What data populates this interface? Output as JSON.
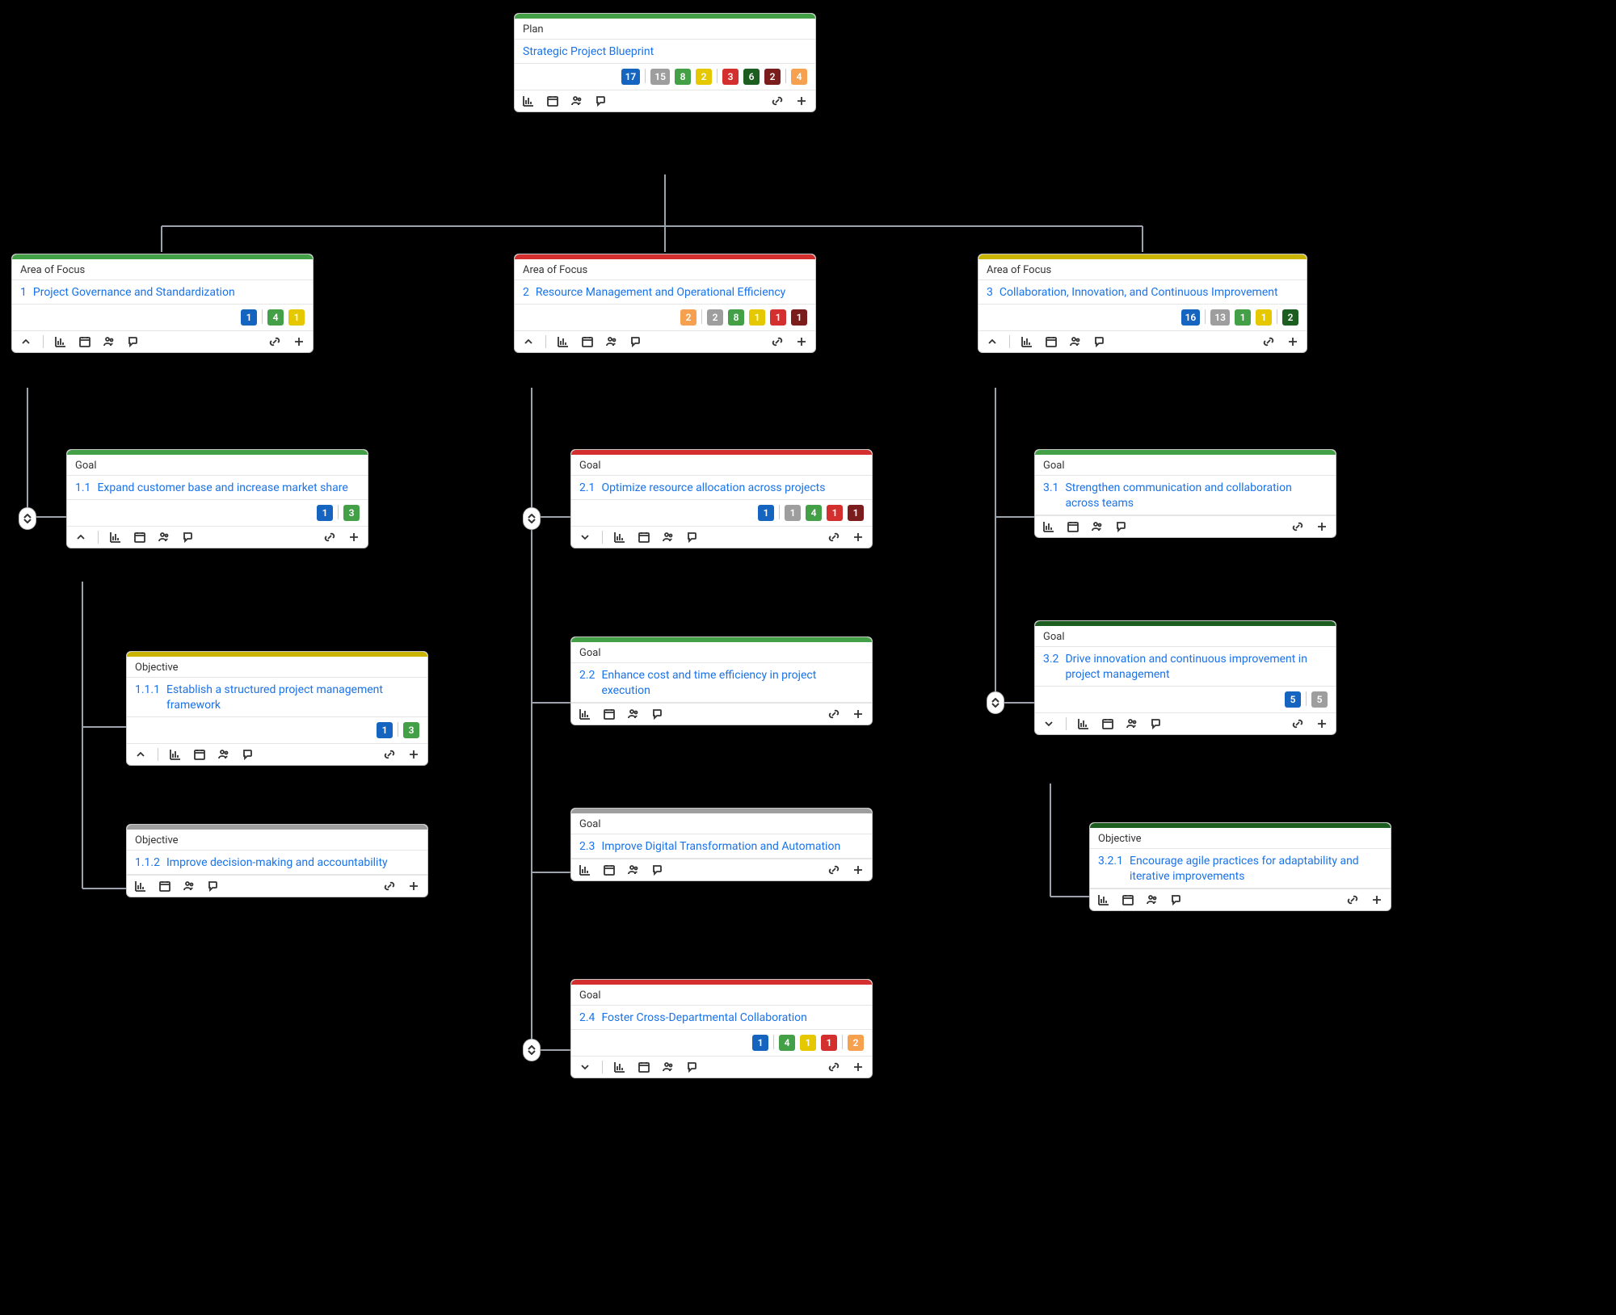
{
  "labels": {
    "plan": "Plan",
    "area": "Area of Focus",
    "goal": "Goal",
    "objective": "Objective"
  },
  "plan": {
    "title": "Strategic Project Blueprint",
    "badges": [
      {
        "color": "c-blue",
        "value": "17"
      },
      {
        "sep": true
      },
      {
        "color": "c-gray",
        "value": "15"
      },
      {
        "color": "c-lime",
        "value": "8"
      },
      {
        "color": "c-yellow",
        "value": "2"
      },
      {
        "sep": true
      },
      {
        "color": "c-red",
        "value": "3"
      },
      {
        "color": "c-dkgreen",
        "value": "6"
      },
      {
        "color": "c-darkred",
        "value": "2"
      },
      {
        "sep": true
      },
      {
        "color": "c-orange",
        "value": "4"
      }
    ]
  },
  "area1": {
    "num": "1",
    "title": "Project Governance and Standardization",
    "badges": [
      {
        "color": "c-blue",
        "value": "1"
      },
      {
        "sep": true
      },
      {
        "color": "c-lime",
        "value": "4"
      },
      {
        "color": "c-yellow",
        "value": "1"
      }
    ]
  },
  "area2": {
    "num": "2",
    "title": "Resource Management and Operational Efficiency",
    "badges": [
      {
        "color": "c-orange",
        "value": "2"
      },
      {
        "sep": true
      },
      {
        "color": "c-gray",
        "value": "2"
      },
      {
        "color": "c-lime",
        "value": "8"
      },
      {
        "color": "c-yellow",
        "value": "1"
      },
      {
        "color": "c-red",
        "value": "1"
      },
      {
        "color": "c-darkred",
        "value": "1"
      }
    ]
  },
  "area3": {
    "num": "3",
    "title": "Collaboration, Innovation, and Continuous Improvement",
    "badges": [
      {
        "color": "c-blue",
        "value": "16"
      },
      {
        "sep": true
      },
      {
        "color": "c-gray",
        "value": "13"
      },
      {
        "color": "c-lime",
        "value": "1"
      },
      {
        "color": "c-yellow",
        "value": "1"
      },
      {
        "sep": true
      },
      {
        "color": "c-dkgreen",
        "value": "2"
      }
    ]
  },
  "goal11": {
    "num": "1.1",
    "title": "Expand customer base and increase market share",
    "badges": [
      {
        "color": "c-blue",
        "value": "1"
      },
      {
        "sep": true
      },
      {
        "color": "c-lime",
        "value": "3"
      }
    ]
  },
  "obj111": {
    "num": "1.1.1",
    "title": "Establish a structured project management framework",
    "badges": [
      {
        "color": "c-blue",
        "value": "1"
      },
      {
        "sep": true
      },
      {
        "color": "c-lime",
        "value": "3"
      }
    ]
  },
  "obj112": {
    "num": "1.1.2",
    "title": "Improve decision-making and accountability"
  },
  "goal21": {
    "num": "2.1",
    "title": "Optimize resource allocation across projects",
    "badges": [
      {
        "color": "c-blue",
        "value": "1"
      },
      {
        "sep": true
      },
      {
        "color": "c-gray",
        "value": "1"
      },
      {
        "color": "c-lime",
        "value": "4"
      },
      {
        "color": "c-red",
        "value": "1"
      },
      {
        "color": "c-darkred",
        "value": "1"
      }
    ]
  },
  "goal22": {
    "num": "2.2",
    "title": "Enhance cost and time efficiency in project execution"
  },
  "goal23": {
    "num": "2.3",
    "title": "Improve Digital Transformation and Automation"
  },
  "goal24": {
    "num": "2.4",
    "title": "Foster Cross-Departmental Collaboration",
    "badges": [
      {
        "color": "c-blue",
        "value": "1"
      },
      {
        "sep": true
      },
      {
        "color": "c-lime",
        "value": "4"
      },
      {
        "color": "c-yellow",
        "value": "1"
      },
      {
        "color": "c-red",
        "value": "1"
      },
      {
        "sep": true
      },
      {
        "color": "c-orange",
        "value": "2"
      }
    ]
  },
  "goal31": {
    "num": "3.1",
    "title": "Strengthen communication and collaboration across teams"
  },
  "goal32": {
    "num": "3.2",
    "title": "Drive innovation and continuous improvement in project management",
    "badges": [
      {
        "color": "c-blue",
        "value": "5"
      },
      {
        "sep": true
      },
      {
        "color": "c-gray",
        "value": "5"
      }
    ]
  },
  "obj321": {
    "num": "3.2.1",
    "title": "Encourage agile practices for adaptability and iterative improvements"
  }
}
